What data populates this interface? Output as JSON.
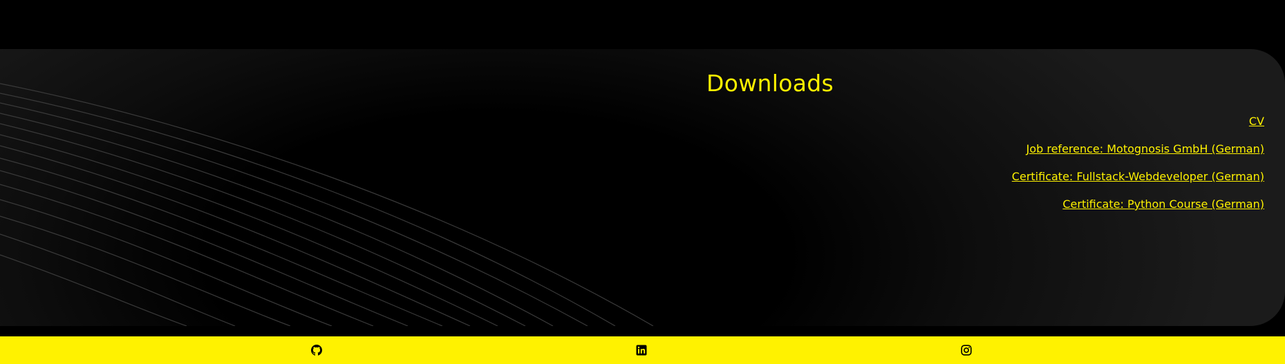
{
  "downloads": {
    "title": "Downloads",
    "links": [
      {
        "label": "CV"
      },
      {
        "label": "Job reference: Motognosis GmbH (German)"
      },
      {
        "label": "Certificate: Fullstack-Webdeveloper (German)"
      },
      {
        "label": "Certificate: Python Course (German)"
      }
    ]
  },
  "footer": {
    "icons": [
      "github-icon",
      "linkedin-icon",
      "instagram-icon"
    ]
  },
  "colors": {
    "accent": "#fff200",
    "background": "#000000",
    "panel": "#1b1b1b"
  }
}
